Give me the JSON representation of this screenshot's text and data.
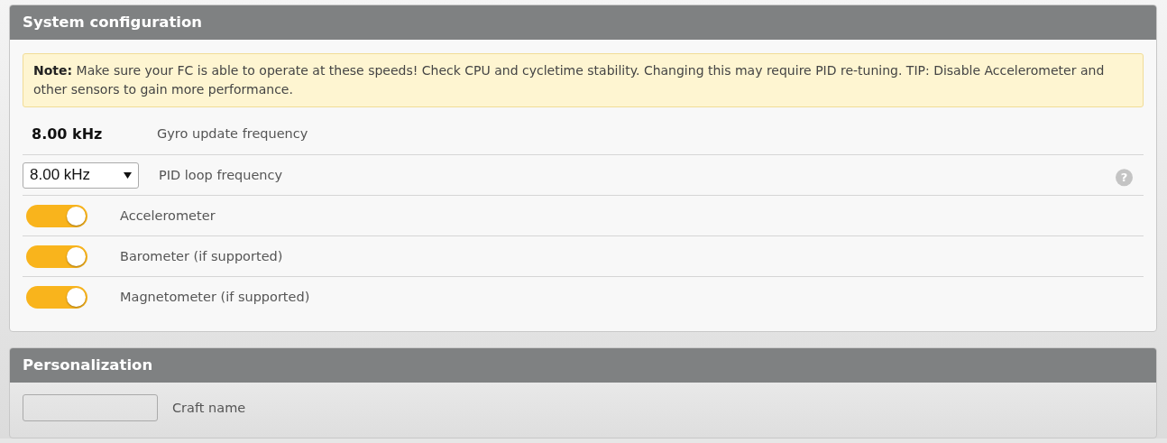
{
  "system_configuration": {
    "title": "System configuration",
    "note": "**Note:** Make sure your FC is able to operate at these speeds! Check CPU and cycletime stability. Changing this may require PID re-tuning. TIP: Disable Accelerometer and other sensors to gain more performance.",
    "rows": [
      {
        "kind": "value",
        "value": "8.00 kHz",
        "label": "Gyro update frequency"
      },
      {
        "kind": "select",
        "value": "8.00 kHz",
        "label": "PID loop frequency",
        "help": "?"
      },
      {
        "kind": "toggle",
        "on": true,
        "label": "Accelerometer"
      },
      {
        "kind": "toggle",
        "on": true,
        "label": "Barometer (if supported)"
      },
      {
        "kind": "toggle",
        "on": true,
        "label": "Magnetometer (if supported)"
      }
    ]
  },
  "personalization": {
    "title": "Personalization",
    "fields": [
      {
        "label": "Craft name"
      }
    ]
  }
}
